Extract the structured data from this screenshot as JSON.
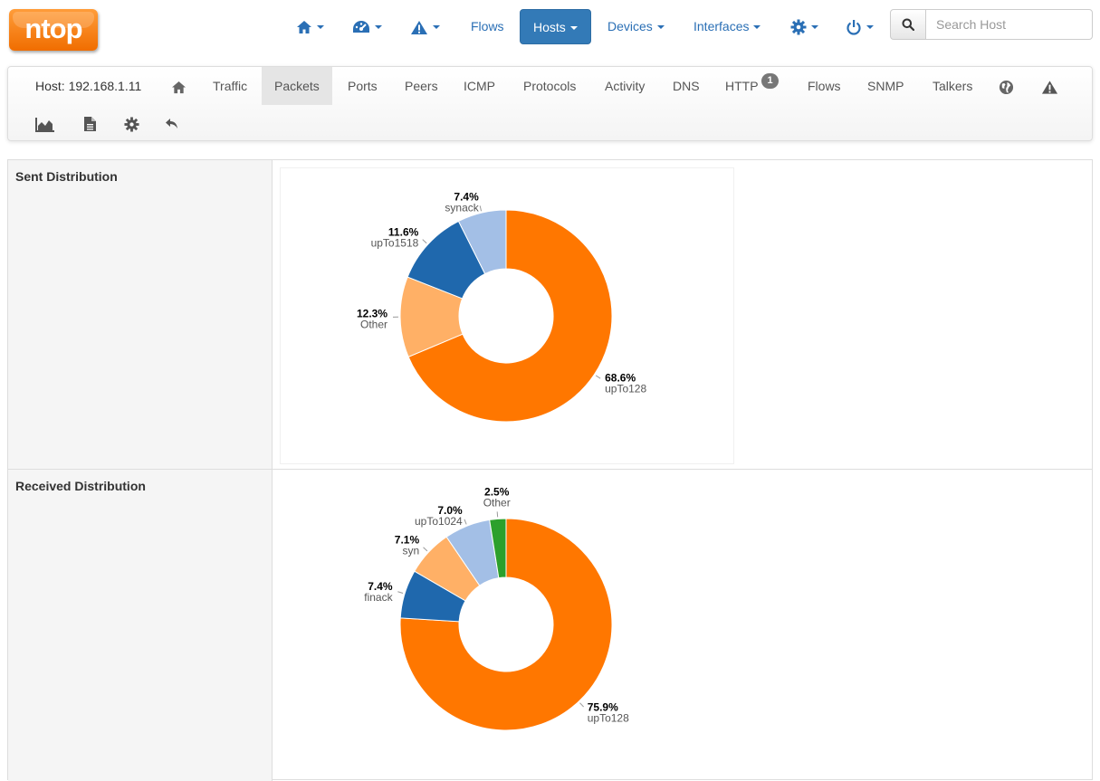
{
  "logo": {
    "text": "ntop"
  },
  "topnav": {
    "home_icon": "home-icon",
    "dashboard_icon": "dashboard-gauge-icon",
    "alerts_icon": "warning-icon",
    "flows_label": "Flows",
    "hosts_label": "Hosts",
    "devices_label": "Devices",
    "interfaces_label": "Interfaces",
    "settings_icon": "gear-icon",
    "power_icon": "power-icon",
    "search_placeholder": "Search Host",
    "active_color": "#337ab7",
    "link_color": "#2a6fb5"
  },
  "hostbar": {
    "host_label": "Host: 192.168.1.11",
    "tabs": [
      {
        "label": "Traffic"
      },
      {
        "label": "Packets",
        "active": true
      },
      {
        "label": "Ports"
      },
      {
        "label": "Peers"
      },
      {
        "label": "ICMP"
      },
      {
        "label": "Protocols"
      },
      {
        "label": "Activity"
      },
      {
        "label": "DNS"
      },
      {
        "label": "HTTP",
        "badge": "1"
      },
      {
        "label": "Flows"
      },
      {
        "label": "SNMP"
      },
      {
        "label": "Talkers"
      }
    ],
    "icons": [
      "home-icon",
      "globe-icon",
      "warning-icon",
      "area-chart-icon",
      "document-icon",
      "gear-icon",
      "back-arrow-icon"
    ]
  },
  "sections": {
    "sent_label": "Sent Distribution",
    "received_label": "Received Distribution"
  },
  "chart_data": [
    {
      "type": "pie",
      "variant": "donut",
      "title": "Sent Distribution",
      "slices": [
        {
          "label": "upTo128",
          "value": 68.6,
          "display": "68.6%",
          "color": "#ff7700"
        },
        {
          "label": "Other",
          "value": 12.3,
          "display": "12.3%",
          "color": "#ffb066"
        },
        {
          "label": "upTo1518",
          "value": 11.6,
          "display": "11.6%",
          "color": "#1f68ad"
        },
        {
          "label": "synack",
          "value": 7.4,
          "display": "7.4%",
          "color": "#a3bfe6"
        }
      ]
    },
    {
      "type": "pie",
      "variant": "donut",
      "title": "Received Distribution",
      "slices": [
        {
          "label": "upTo128",
          "value": 75.9,
          "display": "75.9%",
          "color": "#ff7700"
        },
        {
          "label": "finack",
          "value": 7.4,
          "display": "7.4%",
          "color": "#1f68ad"
        },
        {
          "label": "syn",
          "value": 7.1,
          "display": "7.1%",
          "color": "#ffb066"
        },
        {
          "label": "upTo1024",
          "value": 7.0,
          "display": "7.0%",
          "color": "#a3bfe6"
        },
        {
          "label": "Other",
          "value": 2.5,
          "display": "2.5%",
          "color": "#2ca02c"
        }
      ]
    }
  ]
}
